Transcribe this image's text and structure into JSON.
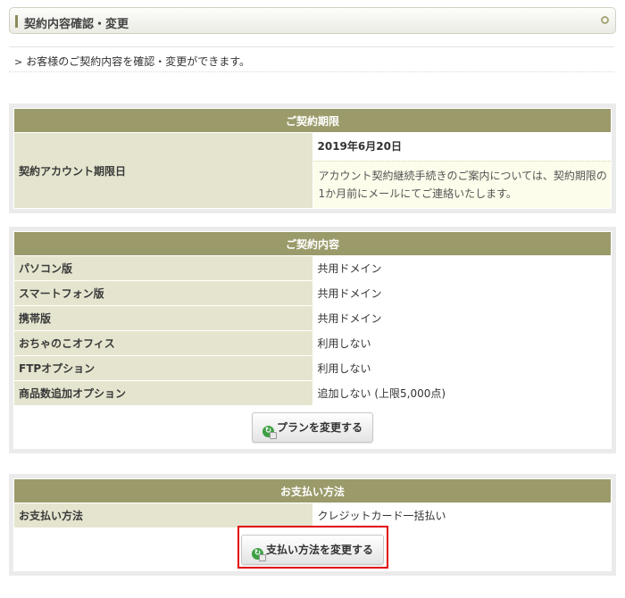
{
  "header": {
    "title": "契約内容確認・変更"
  },
  "intro": {
    "arrow": ">",
    "text": "お客様のご契約内容を確認・変更ができます。"
  },
  "contract_period": {
    "heading": "ご契約期限",
    "label": "契約アカウント期限日",
    "date": "2019年6月20日",
    "note": "アカウント契約継続手続きのご案内については、契約期限の1か月前にメールにてご連絡いたします。"
  },
  "contract_details": {
    "heading": "ご契約内容",
    "rows": [
      {
        "label": "パソコン版",
        "value": "共用ドメイン"
      },
      {
        "label": "スマートフォン版",
        "value": "共用ドメイン"
      },
      {
        "label": "携帯版",
        "value": "共用ドメイン"
      },
      {
        "label": "おちゃのこオフィス",
        "value": "利用しない"
      },
      {
        "label": "FTPオプション",
        "value": "利用しない"
      },
      {
        "label": "商品数追加オプション",
        "value": "追加しない (上限5,000点)"
      }
    ],
    "button_label": "プランを変更する"
  },
  "payment": {
    "heading": "お支払い方法",
    "label": "お支払い方法",
    "value": "クレジットカード一括払い",
    "button_label": "支払い方法を変更する"
  },
  "colors": {
    "section_header": "#9b9a6a",
    "label_cell": "#e5e5cf",
    "highlight": "#e00000"
  },
  "icons": {
    "button_icon": "change-arrow-icon"
  }
}
